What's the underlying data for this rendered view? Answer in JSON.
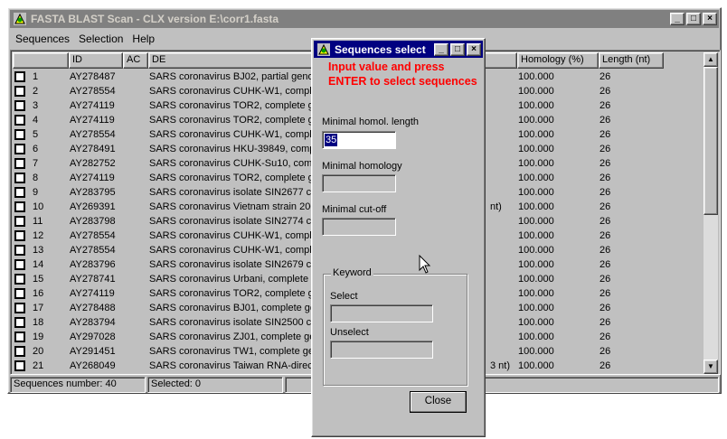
{
  "main_window": {
    "title": "FASTA BLAST Scan - CLX version  E:\\corr1.fasta",
    "buttons": {
      "minimize": "_",
      "maximize": "□",
      "close": "×"
    },
    "menu": [
      "Sequences",
      "Selection",
      "Help"
    ]
  },
  "grid": {
    "columns": [
      "",
      "ID",
      "AC",
      "DE",
      "Homology (%)",
      "Length (nt)"
    ],
    "rows": [
      {
        "n": "1",
        "id": "AY278487",
        "de": "SARS coronavirus BJ02, partial genom",
        "mid": "",
        "hom": "100.000",
        "len": "26"
      },
      {
        "n": "2",
        "id": "AY278554",
        "de": "SARS coronavirus CUHK-W1, comple",
        "mid": "",
        "hom": "100.000",
        "len": "26"
      },
      {
        "n": "3",
        "id": "AY274119",
        "de": "SARS coronavirus TOR2, complete ge",
        "mid": "",
        "hom": "100.000",
        "len": "26"
      },
      {
        "n": "4",
        "id": "AY274119",
        "de": "SARS coronavirus TOR2, complete ge",
        "mid": "",
        "hom": "100.000",
        "len": "26"
      },
      {
        "n": "5",
        "id": "AY278554",
        "de": "SARS coronavirus CUHK-W1, comple",
        "mid": "",
        "hom": "100.000",
        "len": "26"
      },
      {
        "n": "6",
        "id": "AY278491",
        "de": "SARS coronavirus HKU-39849, compl",
        "mid": "",
        "hom": "100.000",
        "len": "26"
      },
      {
        "n": "7",
        "id": "AY282752",
        "de": "SARS coronavirus CUHK-Su10, comp",
        "mid": "",
        "hom": "100.000",
        "len": "26"
      },
      {
        "n": "8",
        "id": "AY274119",
        "de": "SARS coronavirus TOR2, complete ge",
        "mid": "",
        "hom": "100.000",
        "len": "26"
      },
      {
        "n": "9",
        "id": "AY283795",
        "de": "SARS coronavirus isolate SIN2677 co",
        "mid": "",
        "hom": "100.000",
        "len": "26"
      },
      {
        "n": "10",
        "id": "AY269391",
        "de": "SARS coronavirus Vietnam strain 2003",
        "mid": "nt)",
        "hom": "100.000",
        "len": "26"
      },
      {
        "n": "11",
        "id": "AY283798",
        "de": "SARS coronavirus isolate SIN2774 co",
        "mid": "",
        "hom": "100.000",
        "len": "26"
      },
      {
        "n": "12",
        "id": "AY278554",
        "de": "SARS coronavirus CUHK-W1, comple",
        "mid": "",
        "hom": "100.000",
        "len": "26"
      },
      {
        "n": "13",
        "id": "AY278554",
        "de": "SARS coronavirus CUHK-W1, comple",
        "mid": "",
        "hom": "100.000",
        "len": "26"
      },
      {
        "n": "14",
        "id": "AY283796",
        "de": "SARS coronavirus isolate SIN2679 co",
        "mid": "",
        "hom": "100.000",
        "len": "26"
      },
      {
        "n": "15",
        "id": "AY278741",
        "de": "SARS coronavirus Urbani, complete g",
        "mid": "",
        "hom": "100.000",
        "len": "26"
      },
      {
        "n": "16",
        "id": "AY274119",
        "de": "SARS coronavirus TOR2, complete ge",
        "mid": "",
        "hom": "100.000",
        "len": "26"
      },
      {
        "n": "17",
        "id": "AY278488",
        "de": "SARS coronavirus BJ01, complete ge",
        "mid": "",
        "hom": "100.000",
        "len": "26"
      },
      {
        "n": "18",
        "id": "AY283794",
        "de": "SARS coronavirus isolate SIN2500 co",
        "mid": "",
        "hom": "100.000",
        "len": "26"
      },
      {
        "n": "19",
        "id": "AY297028",
        "de": "SARS coronavirus ZJ01, complete ge",
        "mid": "",
        "hom": "100.000",
        "len": "26"
      },
      {
        "n": "20",
        "id": "AY291451",
        "de": "SARS coronavirus TW1, complete ge",
        "mid": "",
        "hom": "100.000",
        "len": "26"
      },
      {
        "n": "21",
        "id": "AY268049",
        "de": "SARS coronavirus Taiwan RNA-direct",
        "mid": "3 nt)",
        "hom": "100.000",
        "len": "26"
      }
    ]
  },
  "status": {
    "count": "Sequences number: 40",
    "selected": "Selected: 0"
  },
  "dialog": {
    "title": "Sequences select",
    "instruction": "Input value and press ENTER to select sequences",
    "min_homol_length_label": "Minimal homol. length",
    "min_homol_length_value": "35",
    "min_homology_label": "Minimal homology",
    "min_cutoff_label": "Minimal cut-off",
    "keyword_group": "Keyword",
    "select_label": "Select",
    "unselect_label": "Unselect",
    "close_label": "Close"
  }
}
